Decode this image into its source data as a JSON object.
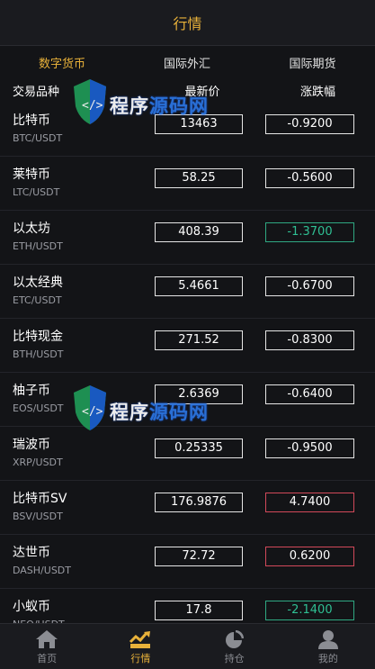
{
  "header": {
    "title": "行情"
  },
  "tabs": [
    {
      "label": "数字货币",
      "active": true
    },
    {
      "label": "国际外汇",
      "active": false
    },
    {
      "label": "国际期货",
      "active": false
    }
  ],
  "columns": {
    "name": "交易品种",
    "price": "最新价",
    "change": "涨跌幅"
  },
  "rows": [
    {
      "name": "比特币",
      "pair": "BTC/USDT",
      "price": "13463",
      "change": "-0.9200",
      "style": "down"
    },
    {
      "name": "莱特币",
      "pair": "LTC/USDT",
      "price": "58.25",
      "change": "-0.5600",
      "style": "down"
    },
    {
      "name": "以太坊",
      "pair": "ETH/USDT",
      "price": "408.39",
      "change": "-1.3700",
      "style": "green"
    },
    {
      "name": "以太经典",
      "pair": "ETC/USDT",
      "price": "5.4661",
      "change": "-0.6700",
      "style": "down"
    },
    {
      "name": "比特现金",
      "pair": "BTH/USDT",
      "price": "271.52",
      "change": "-0.8300",
      "style": "down"
    },
    {
      "name": "柚子币",
      "pair": "EOS/USDT",
      "price": "2.6369",
      "change": "-0.6400",
      "style": "down"
    },
    {
      "name": "瑞波币",
      "pair": "XRP/USDT",
      "price": "0.25335",
      "change": "-0.9500",
      "style": "down"
    },
    {
      "name": "比特币SV",
      "pair": "BSV/USDT",
      "price": "176.9876",
      "change": "4.7400",
      "style": "red"
    },
    {
      "name": "达世币",
      "pair": "DASH/USDT",
      "price": "72.72",
      "change": "0.6200",
      "style": "red"
    },
    {
      "name": "小蚁币",
      "pair": "NEO/USDT",
      "price": "17.8",
      "change": "-2.1400",
      "style": "green"
    }
  ],
  "watermark": {
    "text_a": "程序",
    "text_b": "源码网"
  },
  "tabbar": [
    {
      "label": "首页",
      "icon": "home-icon",
      "active": false
    },
    {
      "label": "行情",
      "icon": "chart-icon",
      "active": true
    },
    {
      "label": "持仓",
      "icon": "pie-icon",
      "active": false
    },
    {
      "label": "我的",
      "icon": "user-icon",
      "active": false
    }
  ],
  "colors": {
    "accent": "#e9b23a",
    "up_border": "#d2495a",
    "down_border": "#2fa882",
    "background": "#131417"
  }
}
